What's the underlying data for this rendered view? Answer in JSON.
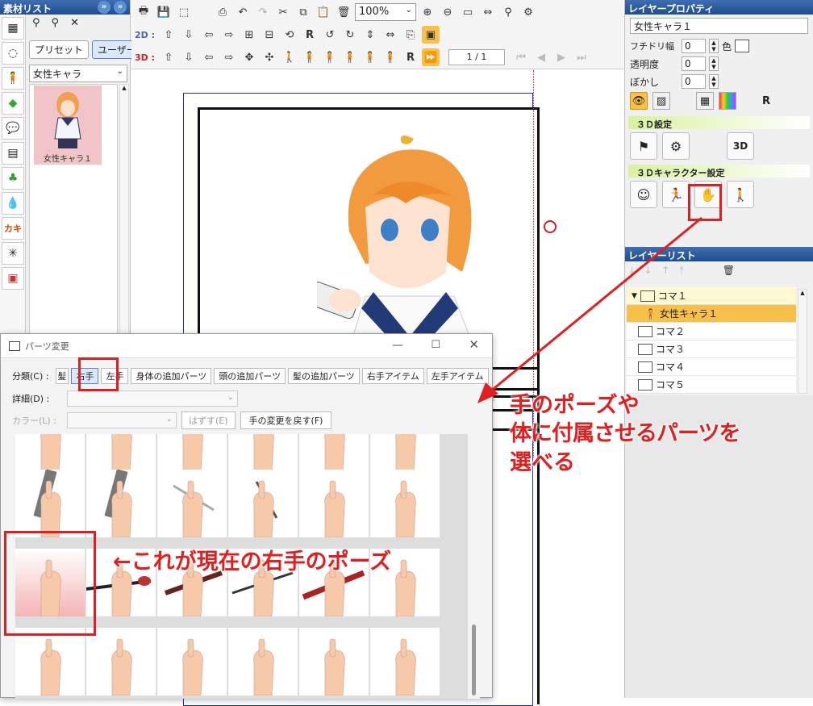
{
  "left_panel": {
    "title": "素材リスト",
    "preset_tab": "プリセット",
    "user_tab": "ユーザー",
    "category_select": "女性キャラ",
    "thumb_label": "女性キャラ１"
  },
  "toolbar": {
    "zoom": "100%",
    "row2_label": "2D :",
    "row3_label": "3D :",
    "r_label": "R",
    "page_indicator": "1 / 1"
  },
  "right_panel": {
    "title": "レイヤープロパティ",
    "layer_name": "女性キャラ１",
    "outline_label": "フチドリ幅",
    "outline_value": "0",
    "color_label": "色",
    "opacity_label": "透明度",
    "opacity_value": "0",
    "blur_label": "ぼかし",
    "blur_value": "0",
    "r_label": "R",
    "section_3d": "３Ｄ設定",
    "section_3d_char": "３Ｄキャラクター設定",
    "layer_list_title": "レイヤーリスト",
    "layers": [
      {
        "name": "コマ１",
        "expanded": true,
        "selected": false
      },
      {
        "name": "女性キャラ１",
        "child": true,
        "selected": true
      },
      {
        "name": "コマ２"
      },
      {
        "name": "コマ３"
      },
      {
        "name": "コマ４"
      },
      {
        "name": "コマ５"
      }
    ]
  },
  "dialog": {
    "title": "パーツ変更",
    "category_label": "分類(C) :",
    "tabs": [
      "髪",
      "右手",
      "左手",
      "身体の追加パーツ",
      "頭の追加パーツ",
      "髪の追加パーツ",
      "右手アイテム",
      "左手アイテム"
    ],
    "selected_tab": "右手",
    "detail_label": "詳細(D) :",
    "color_label": "カラー(L) :",
    "remove_button": "はずす(E)",
    "revert_button": "手の変更を戻す(F)"
  },
  "annotations": {
    "hand_pose": "手のポーズや",
    "hand_pose2": "体に付属させるパーツを",
    "hand_pose3": "選べる",
    "current_pose": "←これが現在の右手のポーズ"
  },
  "colors": {
    "accent_red": "#e02020",
    "header_blue": "#1f4d8f",
    "selected_orange": "#f7c04a"
  }
}
